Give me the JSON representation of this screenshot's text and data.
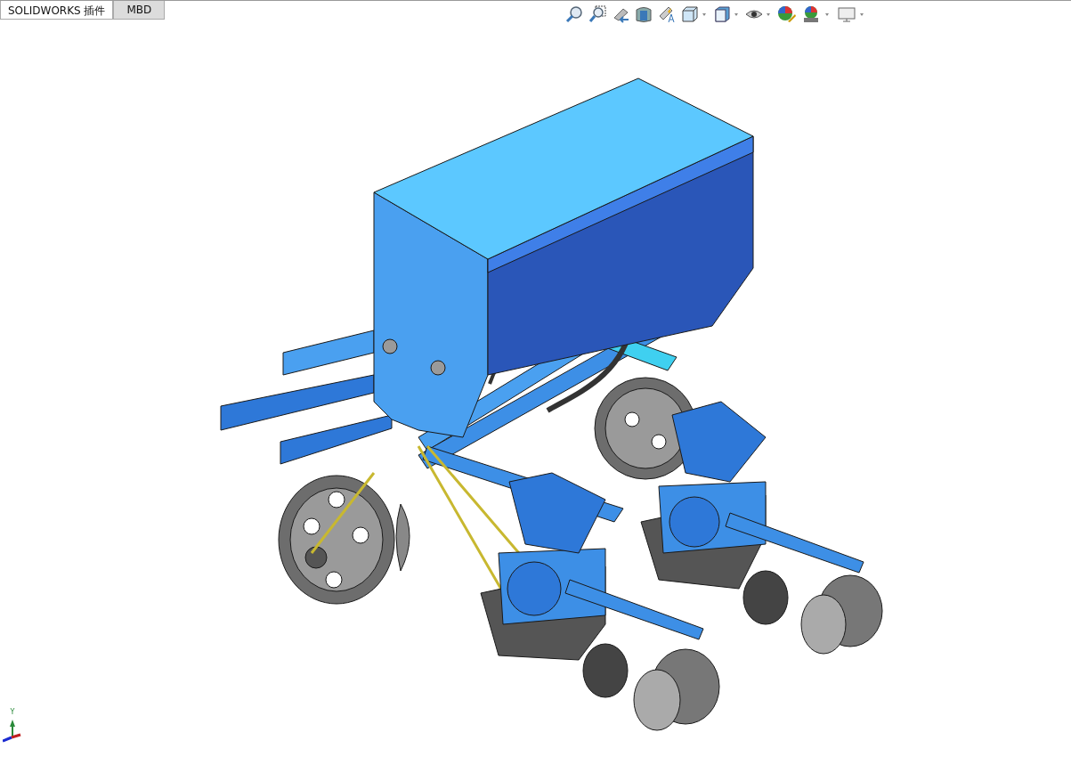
{
  "tabs": [
    {
      "label": "SOLIDWORKS 插件",
      "selected": true
    },
    {
      "label": "MBD",
      "selected": false
    }
  ],
  "triad": {
    "axis_label": "Y"
  }
}
